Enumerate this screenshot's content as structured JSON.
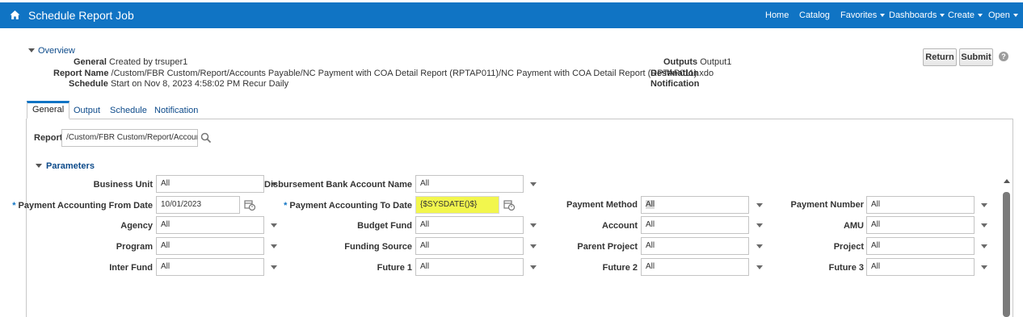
{
  "header": {
    "title": "Schedule Report Job",
    "nav": [
      {
        "label": "Home",
        "caret": false
      },
      {
        "label": "Catalog",
        "caret": false
      },
      {
        "label": "Favorites",
        "caret": true
      },
      {
        "label": "Dashboards",
        "caret": true
      },
      {
        "label": "Create",
        "caret": true
      },
      {
        "label": "Open",
        "caret": true
      }
    ]
  },
  "overview": {
    "title": "Overview",
    "general_label": "General",
    "general_value": "Created by trsuper1",
    "report_name_label": "Report Name",
    "report_name_value": "/Custom/FBR Custom/Report/Accounts Payable/NC Payment with COA Detail Report (RPTAP011)/NC Payment with COA Detail Report (RPTAP011).xdo",
    "schedule_label": "Schedule",
    "schedule_value": "Start on Nov 8, 2023 4:58:02 PM Recur Daily",
    "outputs_label": "Outputs",
    "outputs_value": "Output1",
    "destination_label": "Destination",
    "notification_label": "Notification"
  },
  "actions": {
    "return_label": "Return",
    "submit_label": "Submit",
    "help_glyph": "?"
  },
  "tabs": [
    "General",
    "Output",
    "Schedule",
    "Notification"
  ],
  "report": {
    "label": "Report",
    "value": "/Custom/FBR Custom/Report/Accoun"
  },
  "parameters": {
    "title": "Parameters",
    "business_unit": {
      "label": "Business Unit",
      "value": "All"
    },
    "disbursement_bank_account_name": {
      "label": "Disbursement Bank Account Name",
      "value": "All"
    },
    "payment_accounting_from_date": {
      "label": "Payment Accounting From Date",
      "value": "10/01/2023",
      "required_mark": "*"
    },
    "payment_accounting_to_date": {
      "label": "Payment Accounting To Date",
      "value": "{$SYSDATE()$}",
      "required_mark": "*"
    },
    "payment_method": {
      "label": "Payment Method",
      "value": "All"
    },
    "payment_number": {
      "label": "Payment Number",
      "value": "All"
    },
    "agency": {
      "label": "Agency",
      "value": "All"
    },
    "budget_fund": {
      "label": "Budget Fund",
      "value": "All"
    },
    "account": {
      "label": "Account",
      "value": "All"
    },
    "amu": {
      "label": "AMU",
      "value": "All"
    },
    "program": {
      "label": "Program",
      "value": "All"
    },
    "funding_source": {
      "label": "Funding Source",
      "value": "All"
    },
    "parent_project": {
      "label": "Parent Project",
      "value": "All"
    },
    "project": {
      "label": "Project",
      "value": "All"
    },
    "inter_fund": {
      "label": "Inter Fund",
      "value": "All"
    },
    "future_1": {
      "label": "Future 1",
      "value": "All"
    },
    "future_2": {
      "label": "Future 2",
      "value": "All"
    },
    "future_3": {
      "label": "Future 3",
      "value": "All"
    }
  },
  "colors": {
    "brand_bar": "#1074c4",
    "link": "#0c4a8a",
    "highlight": "#f2f64d"
  }
}
